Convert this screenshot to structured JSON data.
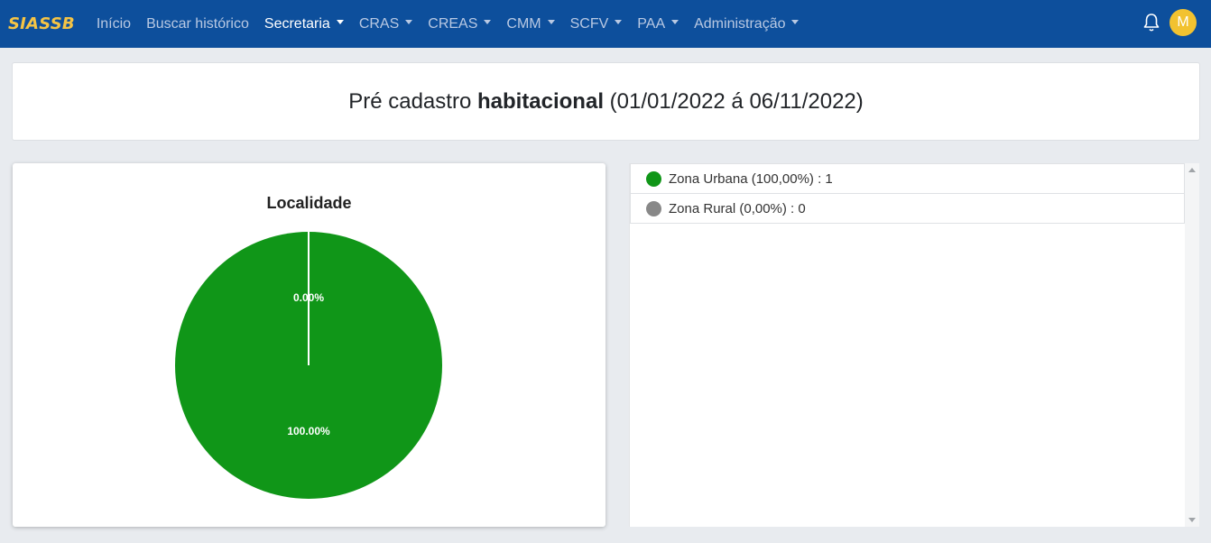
{
  "navbar": {
    "brand": "SIASSB",
    "items": [
      {
        "label": "Início",
        "dropdown": false,
        "active": false
      },
      {
        "label": "Buscar histórico",
        "dropdown": false,
        "active": false
      },
      {
        "label": "Secretaria",
        "dropdown": true,
        "active": true
      },
      {
        "label": "CRAS",
        "dropdown": true,
        "active": false
      },
      {
        "label": "CREAS",
        "dropdown": true,
        "active": false
      },
      {
        "label": "CMM",
        "dropdown": true,
        "active": false
      },
      {
        "label": "SCFV",
        "dropdown": true,
        "active": false
      },
      {
        "label": "PAA",
        "dropdown": true,
        "active": false
      },
      {
        "label": "Administração",
        "dropdown": true,
        "active": false
      }
    ],
    "bell_icon": "bell-icon",
    "avatar_initial": "M"
  },
  "header": {
    "title_prefix": "Pré cadastro ",
    "title_bold": "habitacional",
    "title_suffix": " (01/01/2022 á 06/11/2022)"
  },
  "legend": {
    "items": [
      {
        "label": "Zona Urbana (100,00%) : 1",
        "color": "#109618"
      },
      {
        "label": "Zona Rural (0,00%) : 0",
        "color": "#888888"
      }
    ]
  },
  "chart_data": {
    "type": "pie",
    "title": "Localidade",
    "categories": [
      "Zona Urbana",
      "Zona Rural"
    ],
    "values": [
      1,
      0
    ],
    "slice_labels": [
      "100.00%",
      "0.00%"
    ],
    "colors": [
      "#109618",
      "#888888"
    ]
  },
  "colors": {
    "navbar": "#0d4f9c",
    "brand": "#f5c445",
    "avatar": "#f2c230",
    "background": "#e8ebef"
  }
}
